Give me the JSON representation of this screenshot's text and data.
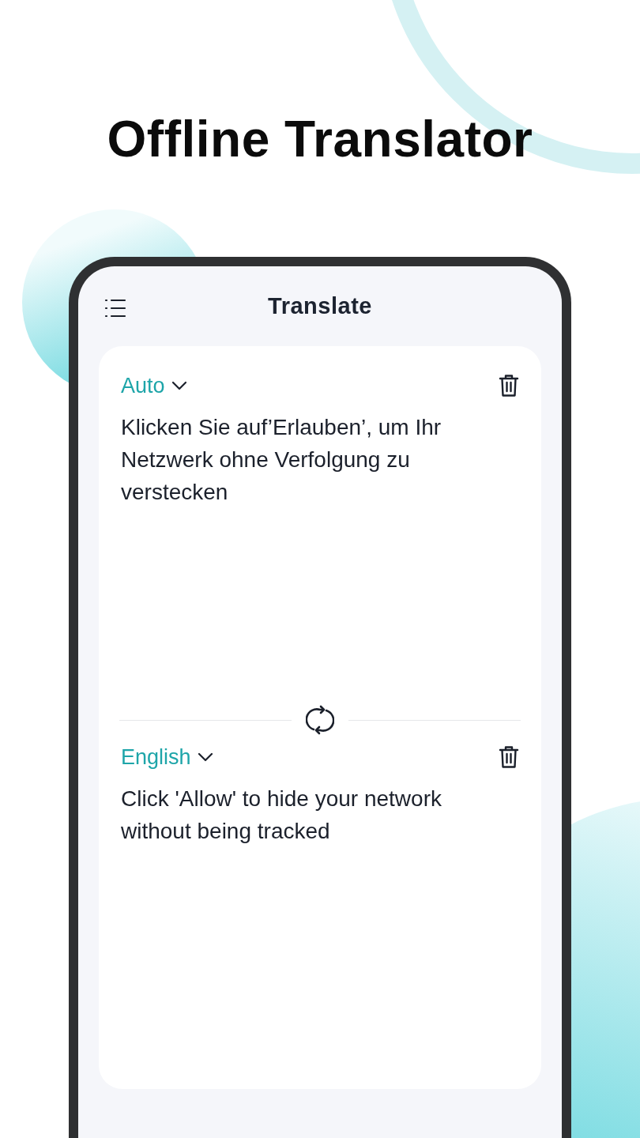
{
  "headline": "Offline Translator",
  "app_bar": {
    "title": "Translate"
  },
  "panels": [
    {
      "language": "Auto",
      "text": "Klicken Sie auf’Erlauben’, um Ihr Netzwerk ohne Verfolgung zu verstecken"
    },
    {
      "language": "English",
      "text": "Click 'Allow' to hide your network without being tracked"
    }
  ]
}
